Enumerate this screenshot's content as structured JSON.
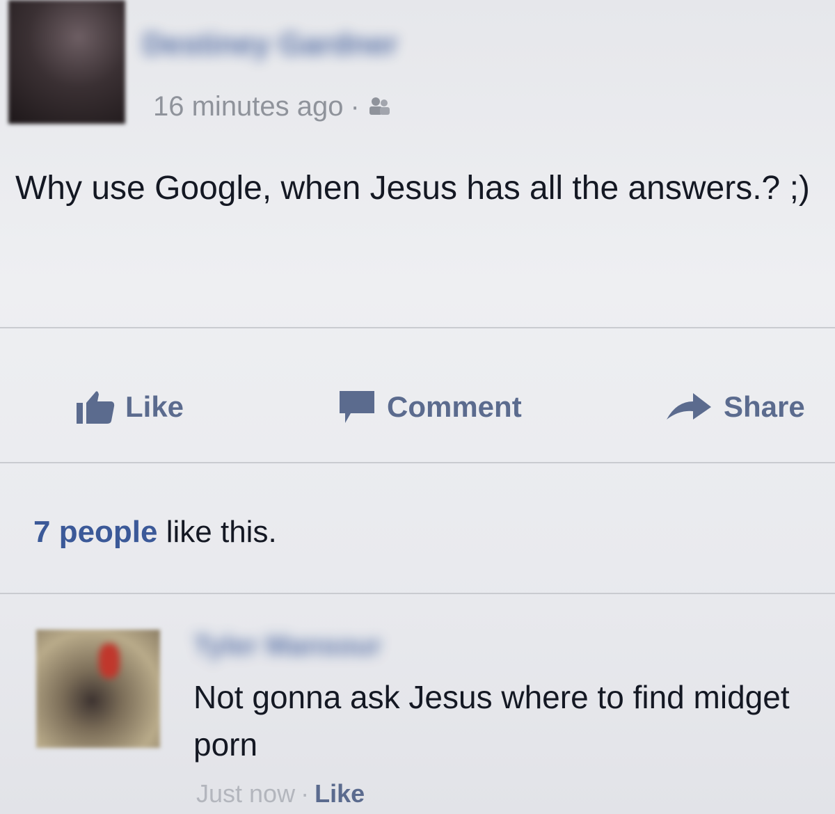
{
  "post": {
    "author_name": "Destiney Gardner",
    "timestamp": "16 minutes ago",
    "separator": "·",
    "audience_icon": "friends-icon",
    "text": "Why use Google, when Jesus has all the answers.? ;)"
  },
  "actions": {
    "like_label": "Like",
    "comment_label": "Comment",
    "share_label": "Share",
    "like_icon": "thumbs-up-icon",
    "comment_icon": "speech-bubble-icon",
    "share_icon": "share-arrow-icon"
  },
  "likes": {
    "count_text": "7 people",
    "suffix_text": " like this."
  },
  "comment": {
    "author_name": "Tyler Mansour",
    "text": "Not gonna ask Jesus where to find midget porn",
    "timestamp": "Just now",
    "separator": "·",
    "like_label": "Like"
  },
  "colors": {
    "link_blue": "#3b5998",
    "action_gray_blue": "#5b6b8e",
    "meta_gray": "#8f939b",
    "text": "#141823"
  }
}
